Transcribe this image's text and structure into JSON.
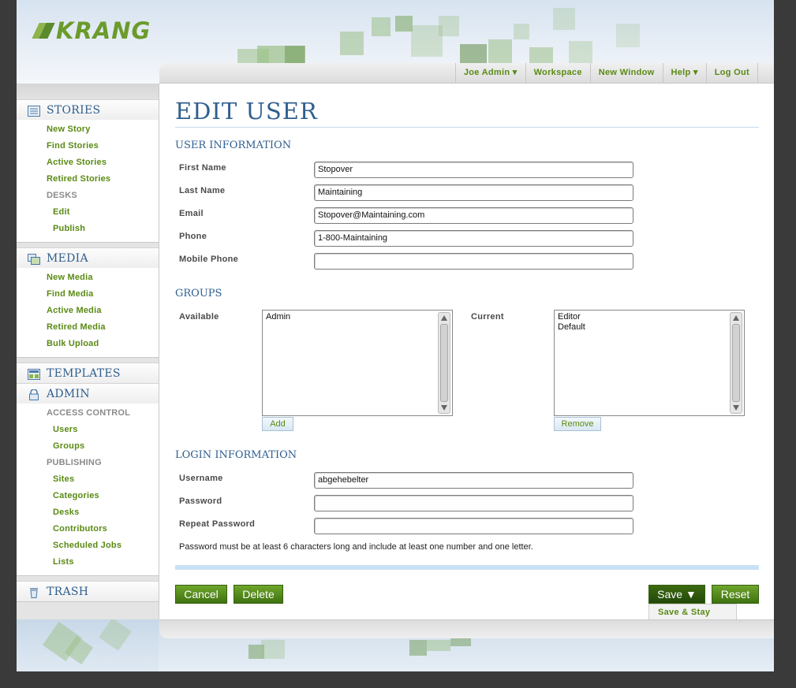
{
  "brand": {
    "name": "KRANG"
  },
  "topnav": {
    "items": [
      {
        "label": "Joe Admin",
        "dropdown": true
      },
      {
        "label": "Workspace"
      },
      {
        "label": "New Window"
      },
      {
        "label": "Help",
        "dropdown": true
      },
      {
        "label": "Log Out"
      }
    ]
  },
  "sidebar": {
    "stories": {
      "title": "STORIES",
      "icon": "stories-icon",
      "items": [
        "New Story",
        "Find Stories",
        "Active Stories",
        "Retired Stories"
      ],
      "desks_label": "DESKS",
      "desks": [
        "Edit",
        "Publish"
      ]
    },
    "media": {
      "title": "MEDIA",
      "icon": "media-icon",
      "items": [
        "New Media",
        "Find Media",
        "Active Media",
        "Retired Media",
        "Bulk Upload"
      ]
    },
    "templates": {
      "title": "TEMPLATES",
      "icon": "templates-icon"
    },
    "admin": {
      "title": "ADMIN",
      "icon": "lock-icon",
      "access_label": "ACCESS CONTROL",
      "access": [
        "Users",
        "Groups"
      ],
      "publishing_label": "PUBLISHING",
      "publishing": [
        "Sites",
        "Categories",
        "Desks",
        "Contributors",
        "Scheduled Jobs",
        "Lists"
      ]
    },
    "trash": {
      "title": "TRASH",
      "icon": "trash-icon"
    }
  },
  "page": {
    "title": "EDIT USER",
    "user_info": {
      "heading": "USER INFORMATION",
      "fields": [
        {
          "label": "First Name",
          "value": "Stopover"
        },
        {
          "label": "Last Name",
          "value": "Maintaining"
        },
        {
          "label": "Email",
          "value": "Stopover@Maintaining.com"
        },
        {
          "label": "Phone",
          "value": "1-800-Maintaining"
        },
        {
          "label": "Mobile Phone",
          "value": ""
        }
      ]
    },
    "groups": {
      "heading": "GROUPS",
      "available_label": "Available",
      "available": [
        "Admin"
      ],
      "add_label": "Add",
      "current_label": "Current",
      "current": [
        "Editor",
        "Default"
      ],
      "remove_label": "Remove"
    },
    "login": {
      "heading": "LOGIN INFORMATION",
      "username_label": "Username",
      "username": "abgehebelter",
      "password_label": "Password",
      "password": "",
      "repeat_label": "Repeat Password",
      "repeat": "",
      "note": "Password must be at least 6 characters long and include at least one number and one letter."
    },
    "actions": {
      "cancel": "Cancel",
      "delete": "Delete",
      "save": "Save ▼",
      "reset": "Reset",
      "save_stay": "Save & Stay"
    }
  },
  "colors": {
    "accent_green": "#5a8a14",
    "heading_blue": "#2f5f8f",
    "button_green": "#4e8a1a"
  }
}
